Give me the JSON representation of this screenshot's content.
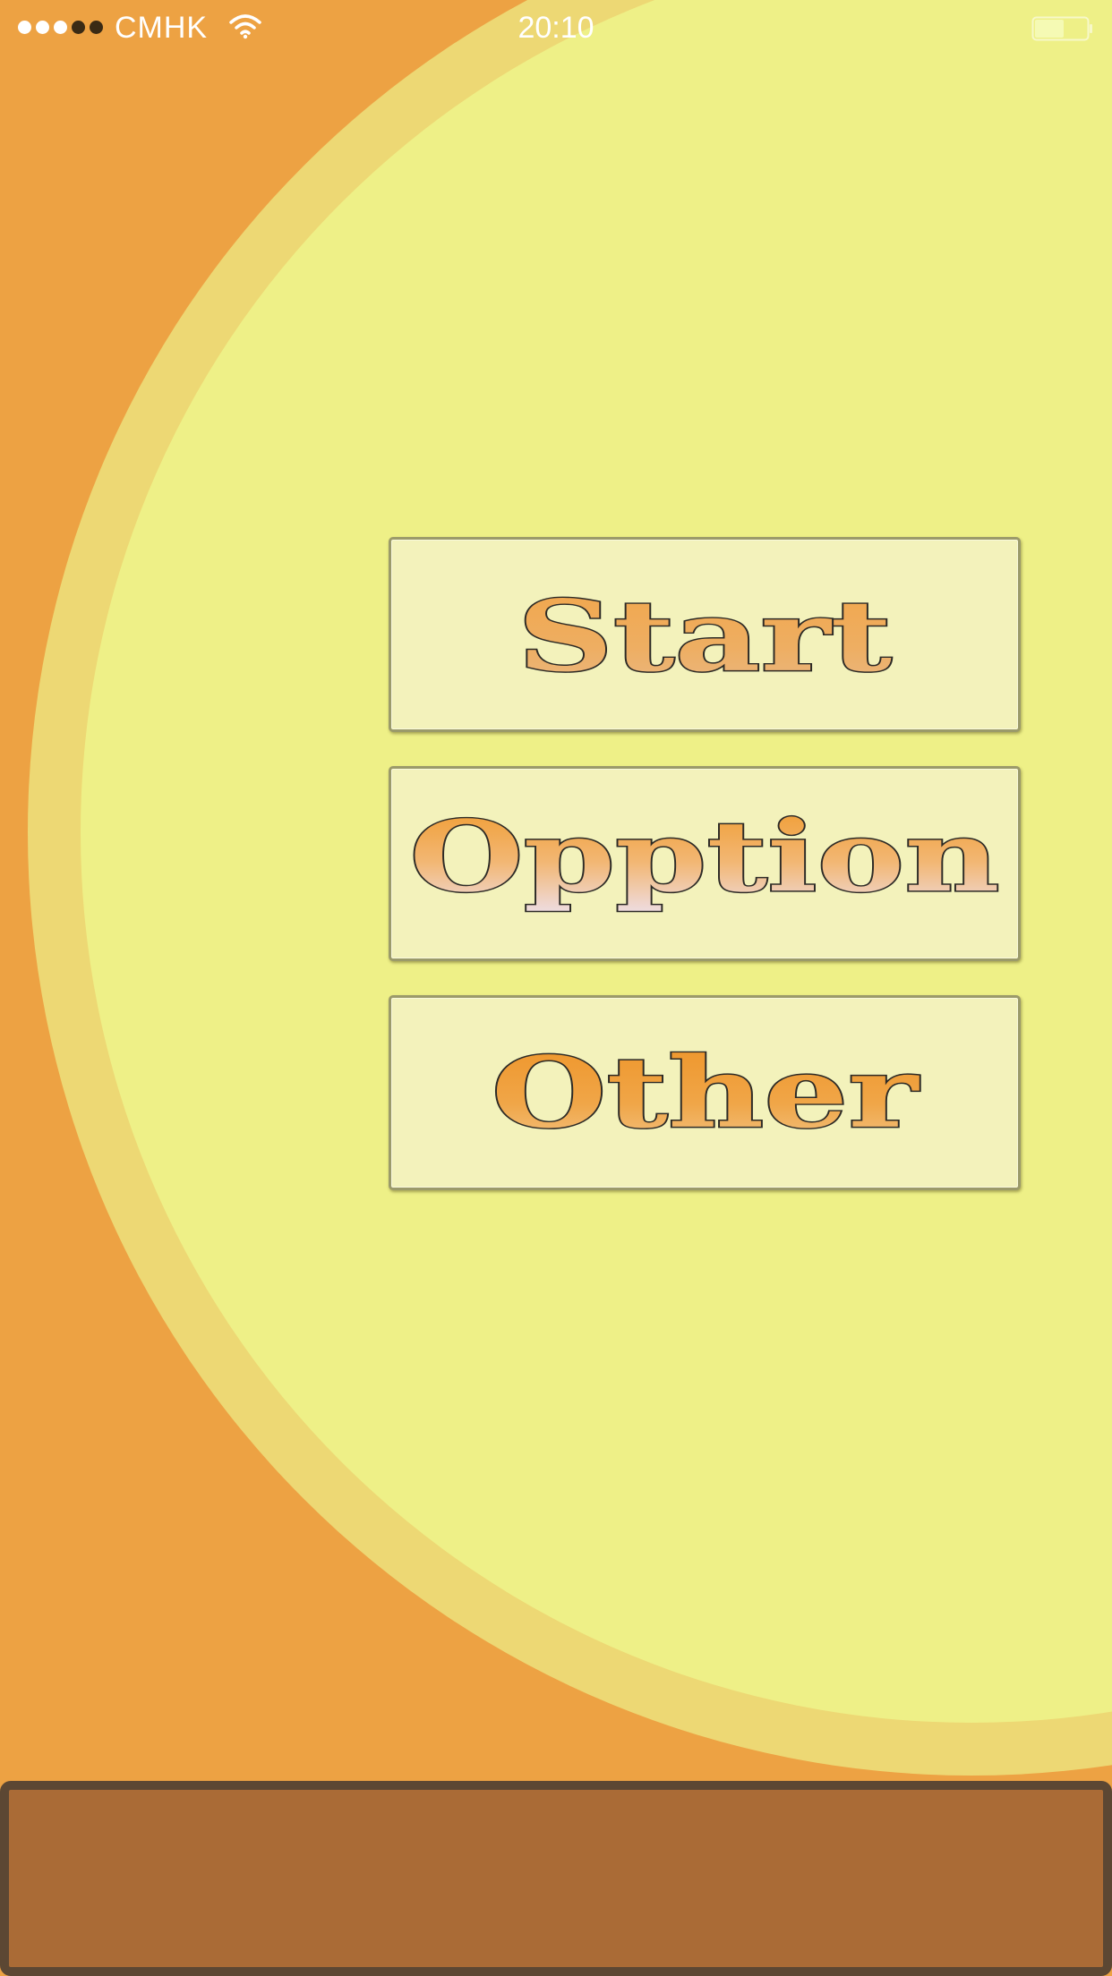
{
  "status_bar": {
    "carrier": "CMHK",
    "time": "20:10",
    "signal_strength": 3,
    "signal_max": 5,
    "signal_icon": "signal-dots-icon",
    "wifi_icon": "wifi-icon",
    "battery_icon": "battery-icon"
  },
  "menu": {
    "start_label": "Start",
    "option_label": "Opption",
    "other_label": "Other"
  },
  "colors": {
    "background_orange": "#EDA243",
    "circle_ring": "#EDD874",
    "circle_fill": "#EEF087",
    "button_fill": "#F3F2BB",
    "label_orange": "#EE9A2E",
    "bottom_panel": "#AA6B36",
    "bottom_panel_border": "#5C4733"
  }
}
